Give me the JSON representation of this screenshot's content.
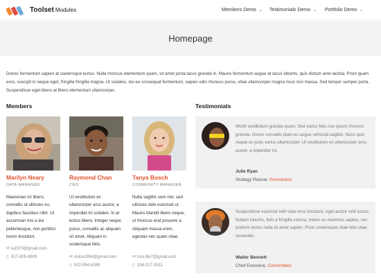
{
  "header": {
    "brand": "Toolset",
    "brand_sub": "Modules",
    "nav": [
      {
        "label": "Members Demo"
      },
      {
        "label": "Testimonials Demo"
      },
      {
        "label": "Portfolio Demo"
      }
    ],
    "caret_icon": "chevron-down-icon"
  },
  "page": {
    "title": "Homepage",
    "intro": "Donec fermentum sapien at scelerisque luctus. Nulla rhoncus elementum quam, sit amet porta lacus gravida in. Mauris fermentum augue at lacus lobortis, quis dictum ante lacinia. Proin quam eros, suscipit in neque eget, fringilla fringilla magna. Ut sodales, dui eu consequat fermentum, sapien odio rhoncus purus, vitae ullamcorper magna risus non massa. Sed tempor semper porta. Suspendisse eget libero at libero elementum ullamcorper."
  },
  "members": {
    "heading": "Members",
    "items": [
      {
        "name": "Marilyn Neary",
        "role": "DATA MANAGER",
        "bio": "Maecenas mi libero, convallis ut ultricies eu, dapibus faucibus nibh. Ut accumsan nisi a dui pellentesque, non porttitor lorem tincidunt.",
        "email": "la1970@gmail.com",
        "phone": "917-805-8809"
      },
      {
        "name": "Raymond Chan",
        "role": "CEO",
        "bio": "Ut vestibulum ex ullamcorper arcu auctor, a imperdiet mi sodales. In at lectus libero. Integer neque purus, convallis ac aliquam sit amet. Aliquam in scelerisque felis.",
        "email": "dulce1994@gmail.com",
        "phone": "502-994-6389"
      },
      {
        "name": "Tanya Bosch",
        "role": "COMMUNITY MANAGER",
        "bio": "Nulla sagittis sem nisl, sed ultricies odio euismod ut. Mauris blandit libero neque, ut rhoncus erat posuere a. Aliquam massa enim, egestas nec quam vitae.",
        "email": "lora.ble7@gmail.com",
        "phone": "334-317-0511"
      }
    ]
  },
  "testimonials": {
    "heading": "Testimonials",
    "items": [
      {
        "quote": "Morbi vestibulum gravida quam. Sed varius felis non ipsum rhoncus gravida. Donec convallis diam eu augue vehicula sagittis. Nunc quis neque ac justo varius ullamcorper. Ut vestibulum ex ullamcorper arcu auctor, a imperdiet mi.",
        "name": "Julie Ryan",
        "position": "Strategy Planner, ",
        "company": "Perisolution"
      },
      {
        "quote": "Suspendisse euismod velit vitae eros tincidunt, eget auctor velit luctus. Nullam lobortis, felis a fringilla viverra, metus ex maximus sapien, nec pretium lectus nulla sit amet sapien. Proin scelerisque vitae felis vitae venenatis.",
        "name": "Walter Bennett",
        "position": "Chief Executive, ",
        "company": "Convertibles"
      }
    ]
  },
  "icons": {
    "email": "envelope-icon",
    "phone": "phone-icon"
  },
  "colors": {
    "accent": "#e2512b",
    "band": "#f3f3f3",
    "card": "#f1f1f1"
  }
}
